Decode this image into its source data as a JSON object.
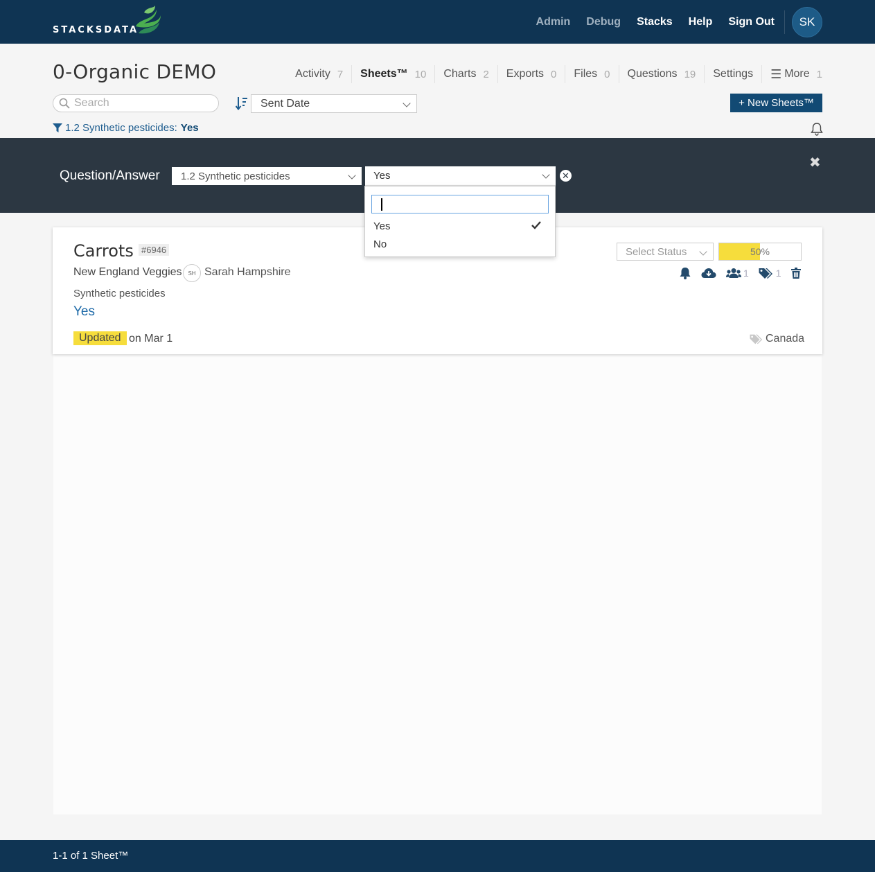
{
  "app": {
    "logo_text": "STACKSDATA",
    "brand_color": "#0f3453",
    "accent_color": "#f6dd3c"
  },
  "topnav": {
    "admin": "Admin",
    "debug": "Debug",
    "stacks": "Stacks",
    "help": "Help",
    "signout": "Sign Out",
    "avatar": "SK"
  },
  "header": {
    "title": "0-Organic DEMO",
    "tabs": [
      {
        "label": "Activity",
        "count": "7"
      },
      {
        "label": "Sheets™",
        "count": "10",
        "active": true
      },
      {
        "label": "Charts",
        "count": "2"
      },
      {
        "label": "Exports",
        "count": "0"
      },
      {
        "label": "Files",
        "count": "0"
      },
      {
        "label": "Questions",
        "count": "19"
      },
      {
        "label": "Settings",
        "count": ""
      },
      {
        "label": "More",
        "count": "1"
      }
    ],
    "search_placeholder": "Search",
    "sort_value": "Sent Date",
    "new_button": "+ New Sheets™"
  },
  "filter": {
    "crumb_question": "1.2 Synthetic pesticides:",
    "crumb_answer": "Yes",
    "label": "Question/Answer",
    "question_value": "1.2 Synthetic pesticides",
    "answer_value": "Yes",
    "options": [
      "Yes",
      "No"
    ],
    "selected_option": "Yes"
  },
  "card": {
    "title": "Carrots",
    "id": "#6946",
    "org": "New England Veggies",
    "owner_initials": "SH",
    "owner": "Sarah Hampshire",
    "question": "Synthetic pesticides",
    "answer": "Yes",
    "updated_badge": "Updated",
    "updated_on": "on Mar 1",
    "status_placeholder": "Select Status",
    "progress_label": "50%",
    "progress_value": 0.5,
    "members_count": "1",
    "tags_count": "1",
    "tag": "Canada"
  },
  "footer": {
    "text": "1-1 of 1 Sheet™"
  }
}
